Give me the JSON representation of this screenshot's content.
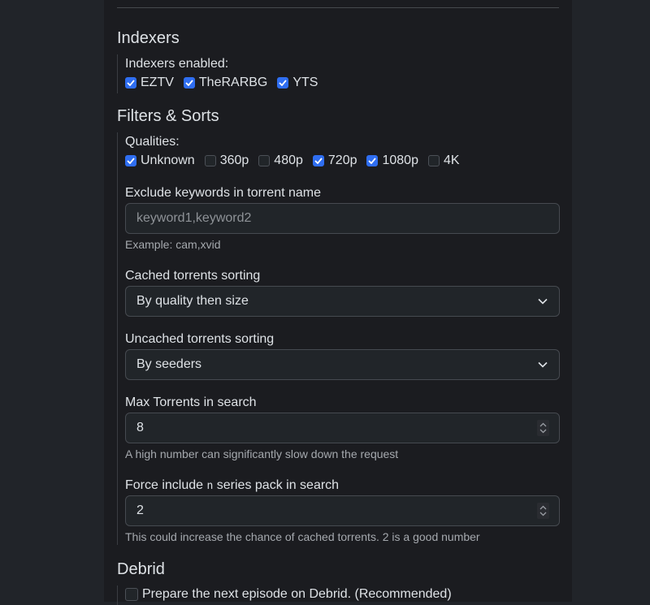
{
  "sections": {
    "indexers": {
      "title": "Indexers",
      "enabled_label": "Indexers enabled:",
      "options": [
        {
          "label": "EZTV",
          "checked": true
        },
        {
          "label": "TheRARBG",
          "checked": true
        },
        {
          "label": "YTS",
          "checked": true
        }
      ]
    },
    "filters": {
      "title": "Filters & Sorts",
      "qualities_label": "Qualities:",
      "qualities": [
        {
          "label": "Unknown",
          "checked": true
        },
        {
          "label": "360p",
          "checked": false
        },
        {
          "label": "480p",
          "checked": false
        },
        {
          "label": "720p",
          "checked": true
        },
        {
          "label": "1080p",
          "checked": true
        },
        {
          "label": "4K",
          "checked": false
        }
      ],
      "exclude_keywords": {
        "label": "Exclude keywords in torrent name",
        "value": "",
        "placeholder": "keyword1,keyword2",
        "help": "Example: cam,xvid"
      },
      "cached_sorting": {
        "label": "Cached torrents sorting",
        "selected": "By quality then size"
      },
      "uncached_sorting": {
        "label": "Uncached torrents sorting",
        "selected": "By seeders"
      },
      "max_torrents": {
        "label": "Max Torrents in search",
        "value": "8",
        "help": "A high number can significantly slow down the request"
      },
      "force_include": {
        "label_pre": "Force include ",
        "label_code": "n",
        "label_post": " series pack in search",
        "value": "2",
        "help": "This could increase the chance of cached torrents. 2 is a good number"
      }
    },
    "debrid": {
      "title": "Debrid",
      "prepare_next": {
        "label": "Prepare the next episode on Debrid. (Recommended)",
        "checked": false
      }
    }
  },
  "colors": {
    "accent": "#2f6ef1",
    "page_bg": "#212429",
    "card_bg": "#1b1c20"
  }
}
